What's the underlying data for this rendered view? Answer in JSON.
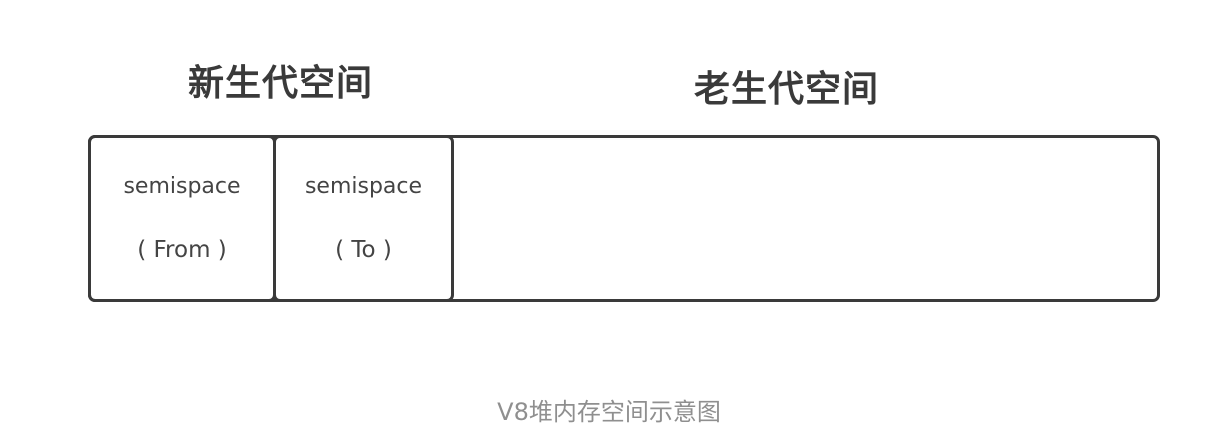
{
  "headings": {
    "young_generation": "新生代空间",
    "old_generation": "老生代空间"
  },
  "semispaces": [
    {
      "label": "semispace",
      "sub": "( From )"
    },
    {
      "label": "semispace",
      "sub": "( To )"
    }
  ],
  "caption": "V8堆内存空间示意图"
}
